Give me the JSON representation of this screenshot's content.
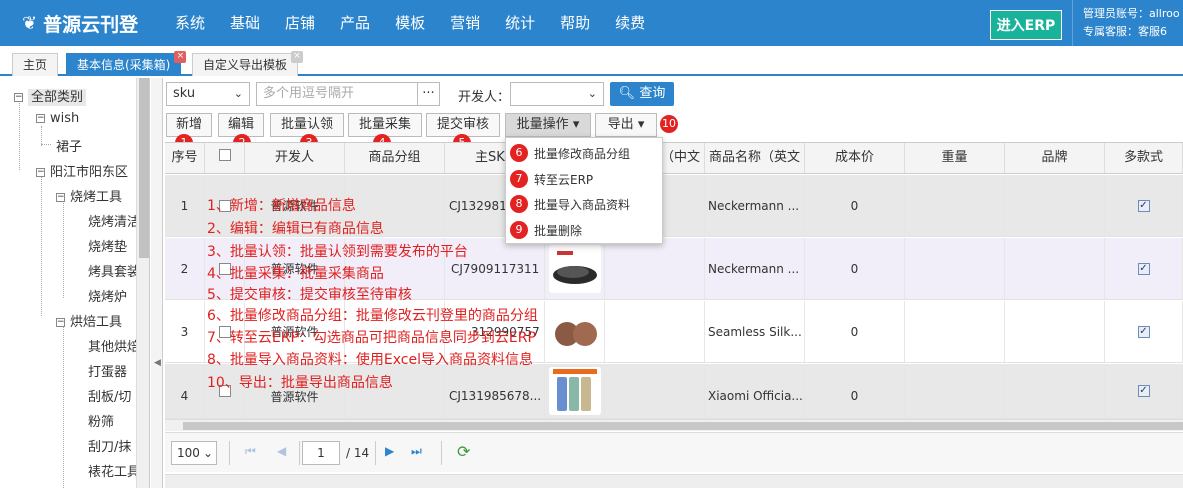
{
  "app": {
    "logo": "普源云刊登",
    "erp_button": "进入ERP",
    "admin_line1": "管理员账号：allroo",
    "admin_line2": "专属客服：客服6"
  },
  "nav": [
    "系统",
    "基础",
    "店铺",
    "产品",
    "模板",
    "营销",
    "统计",
    "帮助",
    "续费"
  ],
  "tabs": [
    {
      "label": "主页"
    },
    {
      "label": "基本信息(采集箱)"
    },
    {
      "label": "自定义导出模板"
    }
  ],
  "sidebar": {
    "items": [
      "全部类别",
      "wish",
      "裙子",
      "阳江市阳东区",
      "烧烤工具",
      "烧烤清洁",
      "烧烤垫",
      "烤具套装",
      "烧烤炉",
      "烘焙工具",
      "其他烘焙",
      "打蛋器",
      "刮板/切",
      "粉筛",
      "刮刀/抹",
      "裱花工具"
    ]
  },
  "filter": {
    "field_select": "sku",
    "input_placeholder": "多个用逗号隔开",
    "more": "···",
    "developer_label": "开发人：",
    "query": "查询"
  },
  "toolbar": {
    "buttons": [
      "新增",
      "编辑",
      "批量认领",
      "批量采集",
      "提交审核",
      "批量操作",
      "导出"
    ],
    "badges": [
      "1",
      "2",
      "3",
      "4",
      "5",
      "10"
    ]
  },
  "dropdown": {
    "items": [
      {
        "num": "6",
        "label": "批量修改商品分组"
      },
      {
        "num": "7",
        "label": "转至云ERP"
      },
      {
        "num": "8",
        "label": "批量导入商品资料"
      },
      {
        "num": "9",
        "label": "批量删除"
      }
    ]
  },
  "table": {
    "headers": [
      "序号",
      "开发人",
      "商品分组",
      "主SKU",
      "商品名称（中文",
      "商品名称（英文",
      "成本价",
      "重量",
      "品牌",
      "多款式"
    ],
    "rows": [
      {
        "index": "1",
        "developer": "普源软件",
        "sku": "CJ132981",
        "name_en": "Neckermann ...",
        "cost": "0"
      },
      {
        "index": "2",
        "developer": "普源软件",
        "sku": "CJ7909117311",
        "name_en": "Neckermann ...",
        "cost": "0"
      },
      {
        "index": "3",
        "developer": "普源软件",
        "sku": "312990757",
        "name_en": "Seamless Silk...",
        "cost": "0"
      },
      {
        "index": "4",
        "developer": "普源软件",
        "sku": "CJ131985678...",
        "name_en": "Xiaomi Officia...",
        "cost": "0"
      }
    ]
  },
  "annotations": [
    "1、新增：新增商品信息",
    "2、编辑：编辑已有商品信息",
    "3、批量认领：批量认领到需要发布的平台",
    "4、批量采集：批量采集商品",
    "5、提交审核：提交审核至待审核",
    "6、批量修改商品分组：批量修改云刊登里的商品分组",
    "7、转至云ERP：勾选商品可把商品信息同步到云ERP",
    "8、批量导入商品资料：使用Excel导入商品资料信息",
    "10、导出：批量导出商品信息"
  ],
  "pager": {
    "page_size": "100",
    "page": "1",
    "total": "/ 14"
  },
  "colors": {
    "primary": "#2b84cc",
    "erp": "#19b29a",
    "annotation": "#e02020"
  }
}
